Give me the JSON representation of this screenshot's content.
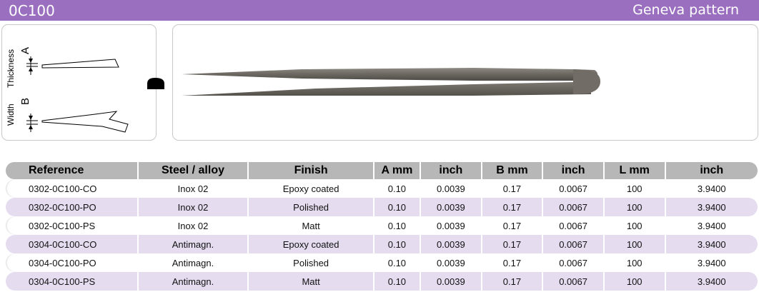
{
  "header": {
    "code": "0C100",
    "pattern": "Geneva pattern",
    "accent_color": "#9b6fbf"
  },
  "diagram": {
    "thickness_label": "Thickness",
    "thickness_letter": "A",
    "width_label": "Width",
    "width_letter": "B"
  },
  "table": {
    "headers": [
      "Reference",
      "Steel / alloy",
      "Finish",
      "A mm",
      "inch",
      "B mm",
      "inch",
      "L mm",
      "inch"
    ],
    "rows": [
      [
        "0302-0C100-CO",
        "Inox 02",
        "Epoxy coated",
        "0.10",
        "0.0039",
        "0.17",
        "0.0067",
        "100",
        "3.9400"
      ],
      [
        "0302-0C100-PO",
        "Inox 02",
        "Polished",
        "0.10",
        "0.0039",
        "0.17",
        "0.0067",
        "100",
        "3.9400"
      ],
      [
        "0302-0C100-PS",
        "Inox 02",
        "Matt",
        "0.10",
        "0.0039",
        "0.17",
        "0.0067",
        "100",
        "3.9400"
      ],
      [
        "0304-0C100-CO",
        "Antimagn.",
        "Epoxy coated",
        "0.10",
        "0.0039",
        "0.17",
        "0.0067",
        "100",
        "3.9400"
      ],
      [
        "0304-0C100-PO",
        "Antimagn.",
        "Polished",
        "0.10",
        "0.0039",
        "0.17",
        "0.0067",
        "100",
        "3.9400"
      ],
      [
        "0304-0C100-PS",
        "Antimagn.",
        "Matt",
        "0.10",
        "0.0039",
        "0.17",
        "0.0067",
        "100",
        "3.9400"
      ]
    ]
  }
}
